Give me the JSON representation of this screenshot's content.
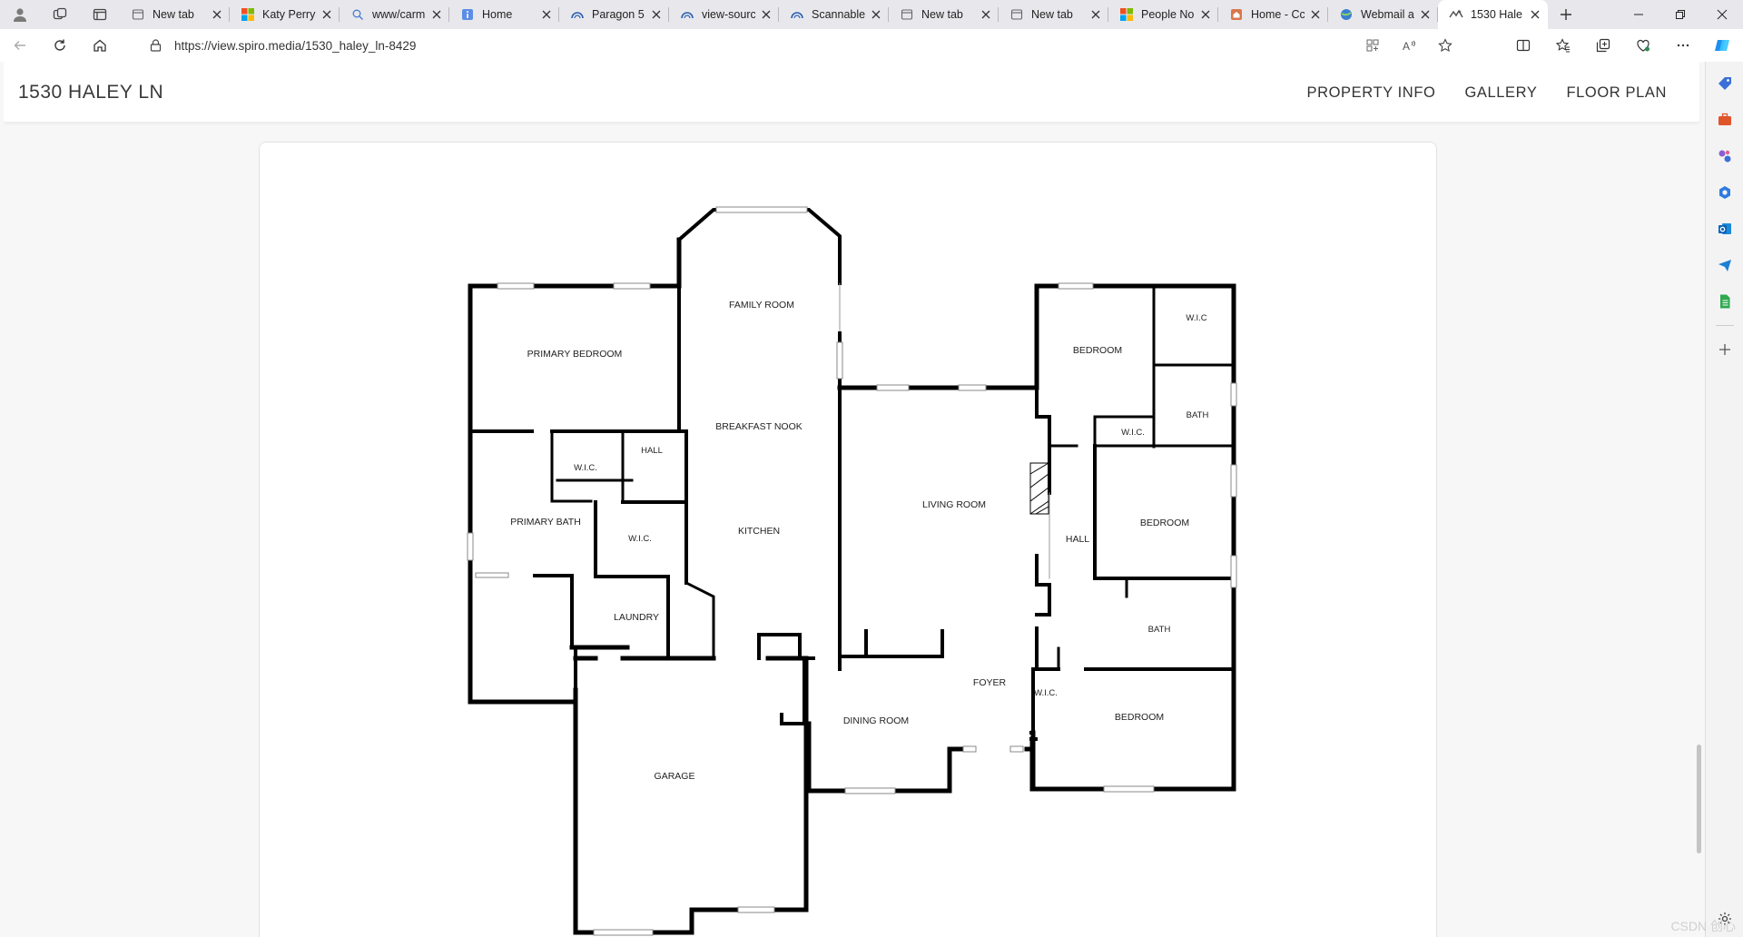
{
  "browser": {
    "tabs": [
      {
        "title": "New tab",
        "icon": "newtab-icon"
      },
      {
        "title": "Katy Perry",
        "icon": "microsoft-icon"
      },
      {
        "title": "www/carm",
        "icon": "search-icon"
      },
      {
        "title": "Home",
        "icon": "info-icon"
      },
      {
        "title": "Paragon 5",
        "icon": "paragon-icon"
      },
      {
        "title": "view-sourc",
        "icon": "paragon-icon"
      },
      {
        "title": "Scannable",
        "icon": "paragon-icon"
      },
      {
        "title": "New tab",
        "icon": "newtab-icon"
      },
      {
        "title": "New tab",
        "icon": "newtab-icon"
      },
      {
        "title": "People No",
        "icon": "microsoft-icon"
      },
      {
        "title": "Home - Cc",
        "icon": "home-icon"
      },
      {
        "title": "Webmail a",
        "icon": "globe-icon"
      },
      {
        "title": "1530 Hale",
        "icon": "spiro-icon",
        "active": true
      }
    ],
    "url": "https://view.spiro.media/1530_haley_ln-8429"
  },
  "site": {
    "title": "1530 HALEY LN",
    "nav": [
      "PROPERTY INFO",
      "GALLERY",
      "FLOOR PLAN"
    ]
  },
  "floorplan": {
    "rooms": {
      "primary_bedroom": "PRIMARY BEDROOM",
      "family_room": "FAMILY ROOM",
      "breakfast_nook": "BREAKFAST NOOK",
      "kitchen": "KITCHEN",
      "wic_1": "W.I.C.",
      "hall_1": "HALL",
      "primary_bath": "PRIMARY BATH",
      "wic_2": "W.I.C.",
      "laundry": "LAUNDRY",
      "garage": "GARAGE",
      "living_room": "LIVING ROOM",
      "dining_room": "DINING ROOM",
      "foyer": "FOYER",
      "bedroom_1": "BEDROOM",
      "wic_3": "W.I.C",
      "bath_1": "BATH",
      "wic_4": "W.I.C.",
      "bedroom_2": "BEDROOM",
      "hall_2": "HALL",
      "bath_2": "BATH",
      "wic_5": "W.I.C.",
      "bedroom_3": "BEDROOM"
    }
  },
  "watermark": "CSDN 创心"
}
